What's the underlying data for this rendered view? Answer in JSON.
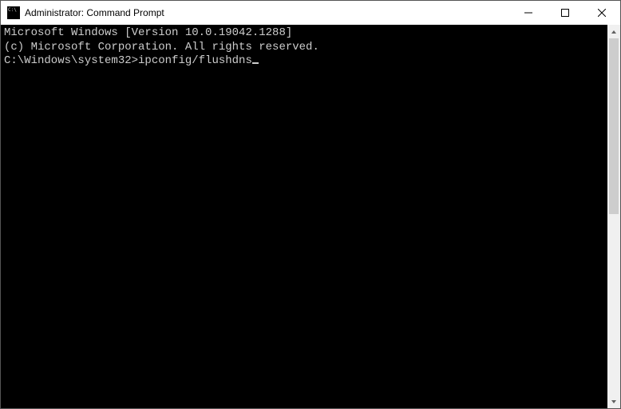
{
  "window": {
    "title": "Administrator: Command Prompt"
  },
  "terminal": {
    "line1": "Microsoft Windows [Version 10.0.19042.1288]",
    "line2": "(c) Microsoft Corporation. All rights reserved.",
    "blank": "",
    "prompt": "C:\\Windows\\system32>",
    "command": "ipconfig/flushdns"
  }
}
